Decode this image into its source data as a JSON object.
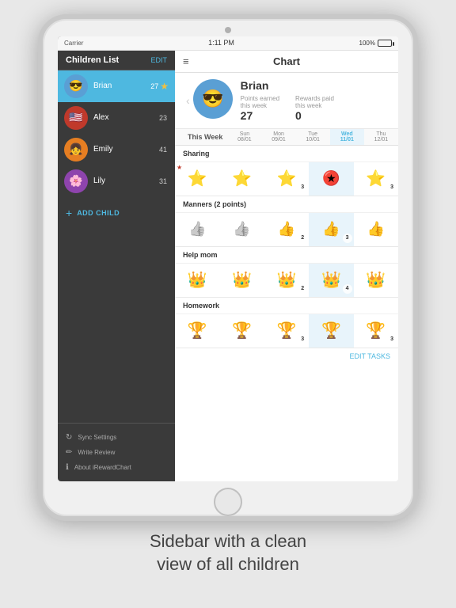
{
  "statusBar": {
    "carrier": "Carrier",
    "time": "1:11 PM",
    "battery": "100%"
  },
  "sidebar": {
    "title": "Children List",
    "editLabel": "EDIT",
    "children": [
      {
        "name": "Brian",
        "points": 27,
        "active": true,
        "avatar": "brian",
        "emoji": "😎"
      },
      {
        "name": "Alex",
        "points": 23,
        "active": false,
        "avatar": "alex",
        "emoji": "🇺🇸"
      },
      {
        "name": "Emily",
        "points": 41,
        "active": false,
        "avatar": "emily",
        "emoji": "👧"
      },
      {
        "name": "Lily",
        "points": 31,
        "active": false,
        "avatar": "lily",
        "emoji": "🌸"
      }
    ],
    "addChildLabel": "ADD CHILD",
    "footer": [
      {
        "icon": "↻",
        "label": "Sync Settings"
      },
      {
        "icon": "✏",
        "label": "Write Review"
      },
      {
        "icon": "ℹ",
        "label": "About iRewardChart"
      }
    ]
  },
  "main": {
    "menuIcon": "≡",
    "title": "Chart",
    "profile": {
      "name": "Brian",
      "pointsLabel": "Points earned",
      "pointsSubLabel": "this week",
      "pointsValue": "27",
      "rewardsLabel": "Rewards paid",
      "rewardsSubLabel": "this week",
      "rewardsValue": "0"
    },
    "weekLabel": "This Week",
    "days": [
      {
        "name": "Sun",
        "date": "08/01",
        "today": false
      },
      {
        "name": "Mon",
        "date": "09/01",
        "today": false
      },
      {
        "name": "Tue",
        "date": "10/01",
        "today": false
      },
      {
        "name": "Wed",
        "date": "11/01",
        "today": true
      },
      {
        "name": "Thu",
        "date": "12/01",
        "today": false
      }
    ],
    "tasks": [
      {
        "name": "Sharing",
        "rows": [
          {
            "cells": [
              {
                "icon": "⭐",
                "color": "red",
                "badge": null
              },
              {
                "icon": "⭐",
                "color": "gold",
                "badge": null
              },
              {
                "icon": "3",
                "type": "star-num",
                "badge": "3"
              },
              {
                "icon": "⭐",
                "color": "red",
                "badge": null
              },
              {
                "icon": "3",
                "type": "star-num",
                "badge": "3"
              }
            ]
          }
        ]
      },
      {
        "name": "Manners (2 points)",
        "rows": [
          {
            "cells": [
              {
                "icon": "👍",
                "color": "grey",
                "badge": null
              },
              {
                "icon": "👍",
                "color": "grey",
                "badge": null
              },
              {
                "icon": "👍",
                "color": "blue",
                "badge": "2"
              },
              {
                "icon": "👍",
                "color": "blue",
                "badge": "3"
              },
              {
                "icon": "👍",
                "color": "blue",
                "badge": null
              }
            ]
          }
        ]
      },
      {
        "name": "Help mom",
        "rows": [
          {
            "cells": [
              {
                "icon": "👑",
                "color": "gold",
                "badge": null
              },
              {
                "icon": "👑",
                "color": "red",
                "badge": null
              },
              {
                "icon": "👑",
                "color": "gold",
                "badge": "2"
              },
              {
                "icon": "👑",
                "color": "gold",
                "badge": "4"
              },
              {
                "icon": "👑",
                "color": "red",
                "badge": null
              }
            ]
          }
        ]
      },
      {
        "name": "Homework",
        "rows": [
          {
            "cells": [
              {
                "icon": "🏆",
                "color": "red",
                "badge": null
              },
              {
                "icon": "🏆",
                "color": "gold",
                "badge": null
              },
              {
                "icon": "🏆",
                "color": "gold",
                "badge": "3"
              },
              {
                "icon": "🏆",
                "color": "red",
                "badge": null
              },
              {
                "icon": "🏆",
                "color": "gold",
                "badge": "3"
              }
            ]
          }
        ]
      }
    ],
    "editTasksLabel": "EDIT TASKS"
  },
  "caption": "Sidebar with a clean\nview of all children"
}
